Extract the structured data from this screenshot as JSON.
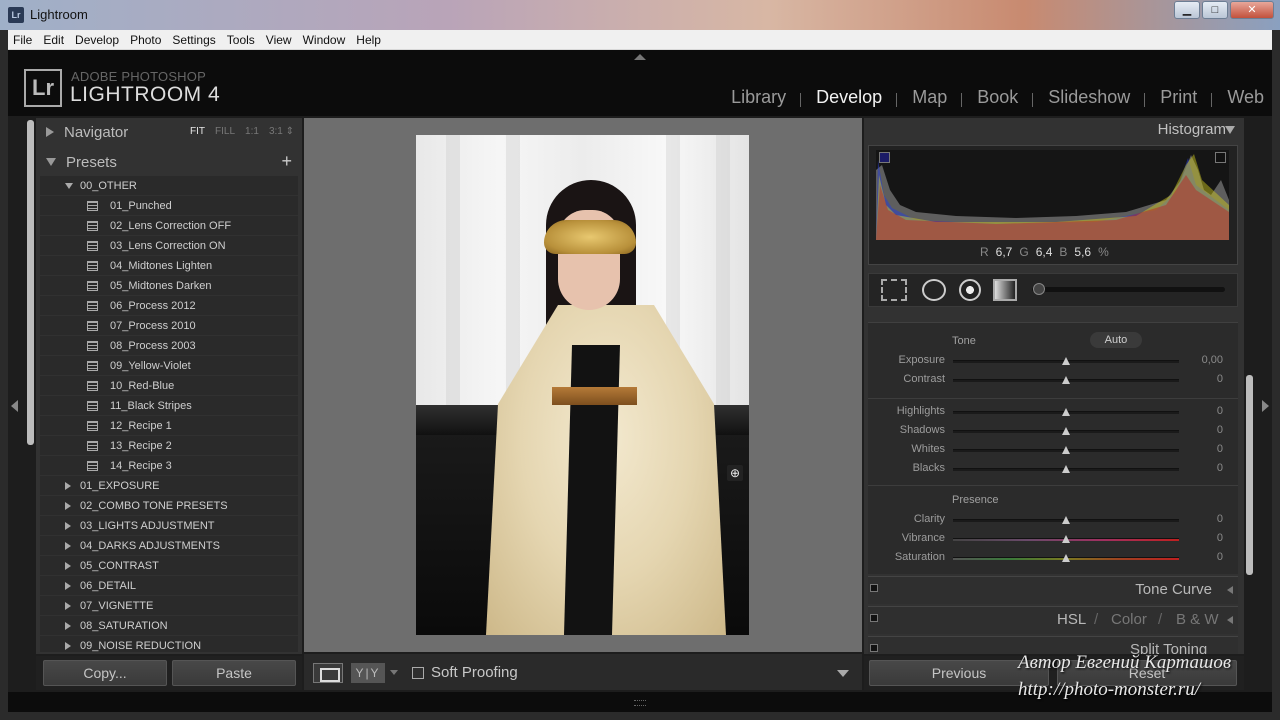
{
  "window": {
    "title": "Lightroom",
    "icon": "Lr",
    "minimize": "▁",
    "maximize": "□",
    "close": "✕"
  },
  "menu": [
    "File",
    "Edit",
    "Develop",
    "Photo",
    "Settings",
    "Tools",
    "View",
    "Window",
    "Help"
  ],
  "identity": {
    "badge": "Lr",
    "line1": "ADOBE PHOTOSHOP",
    "line2": "LIGHTROOM 4"
  },
  "modules": [
    "Library",
    "Develop",
    "Map",
    "Book",
    "Slideshow",
    "Print",
    "Web"
  ],
  "active_module": "Develop",
  "navigator": {
    "title": "Navigator",
    "zoom": [
      "FIT",
      "FILL",
      "1:1",
      "3:1 ⇕"
    ],
    "active_zoom": "FIT"
  },
  "presets": {
    "title": "Presets",
    "add_icon": "+",
    "open_folder": "00_OTHER",
    "items": [
      "01_Punched",
      "02_Lens Correction OFF",
      "03_Lens Correction ON",
      "04_Midtones Lighten",
      "05_Midtones Darken",
      "06_Process 2012",
      "07_Process 2010",
      "08_Process 2003",
      "09_Yellow-Violet",
      "10_Red-Blue",
      "11_Black Stripes",
      "12_Recipe 1",
      "13_Recipe 2",
      "14_Recipe 3"
    ],
    "folders": [
      "01_EXPOSURE",
      "02_COMBO TONE PRESETS",
      "03_LIGHTS ADJUSTMENT",
      "04_DARKS ADJUSTMENTS",
      "05_CONTRAST",
      "06_DETAIL",
      "07_VIGNETTE",
      "08_SATURATION",
      "09_NOISE REDUCTION"
    ]
  },
  "left_buttons": {
    "copy": "Copy...",
    "paste": "Paste"
  },
  "toolbar": {
    "yy": "Y|Y",
    "soft_proofing": "Soft Proofing"
  },
  "histogram": {
    "title": "Histogram",
    "r_label": "R",
    "r": "6,7",
    "g_label": "G",
    "g": "6,4",
    "b_label": "B",
    "b": "5,6",
    "unit": "%"
  },
  "basic": {
    "tone_label": "Tone",
    "auto": "Auto",
    "presence_label": "Presence",
    "sliders": [
      {
        "label": "Exposure",
        "value": "0,00"
      },
      {
        "label": "Contrast",
        "value": "0"
      },
      {
        "label": "Highlights",
        "value": "0"
      },
      {
        "label": "Shadows",
        "value": "0"
      },
      {
        "label": "Whites",
        "value": "0"
      },
      {
        "label": "Blacks",
        "value": "0"
      },
      {
        "label": "Clarity",
        "value": "0"
      },
      {
        "label": "Vibrance",
        "value": "0"
      },
      {
        "label": "Saturation",
        "value": "0"
      }
    ]
  },
  "panels": {
    "tone_curve": "Tone Curve",
    "hsl": "HSL",
    "color": "Color",
    "bw": "B & W",
    "split_toning": "Split Toning"
  },
  "right_buttons": {
    "previous": "Previous",
    "reset": "Reset"
  },
  "watermark": {
    "line1": "Автор Евгений Карташов",
    "line2": "http://photo-monster.ru/"
  }
}
